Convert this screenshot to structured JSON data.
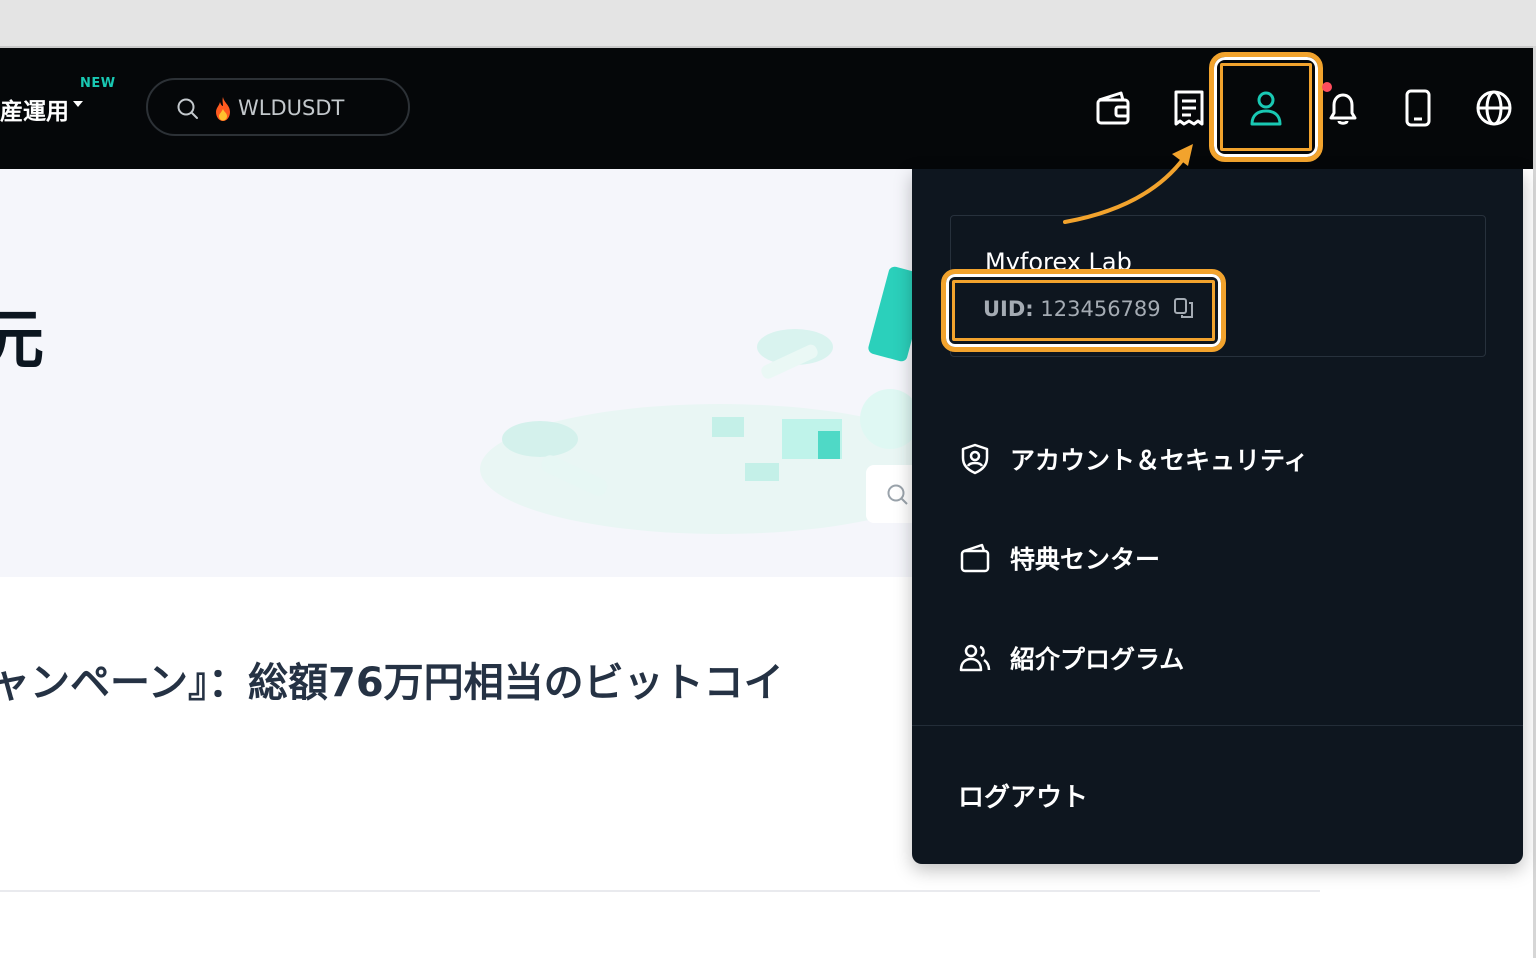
{
  "header": {
    "menu_label": "産運用",
    "new_badge": "NEW",
    "search": {
      "text": "WLDUSDT"
    },
    "icons": [
      "wallet-icon",
      "orders-icon",
      "user-icon",
      "bell-icon",
      "mobile-icon",
      "globe-icon"
    ]
  },
  "banner": {
    "title_fragment": "元"
  },
  "article": {
    "headline": "ャンペーン』：総額76万円相当のビットコイ"
  },
  "account_menu": {
    "username": "Myforex Lab",
    "uid_label": "UID:",
    "uid_value": "123456789",
    "items": [
      {
        "label": "アカウント＆セキュリティ",
        "icon": "shield-user-icon"
      },
      {
        "label": "特典センター",
        "icon": "rewards-bag-icon"
      },
      {
        "label": "紹介プログラム",
        "icon": "referral-users-icon"
      }
    ],
    "logout_label": "ログアウト"
  },
  "colors": {
    "accent_teal": "#19c8b3",
    "highlight_orange": "#f2a32d",
    "nav_bg": "#050709",
    "dropdown_bg": "#0e161f"
  }
}
